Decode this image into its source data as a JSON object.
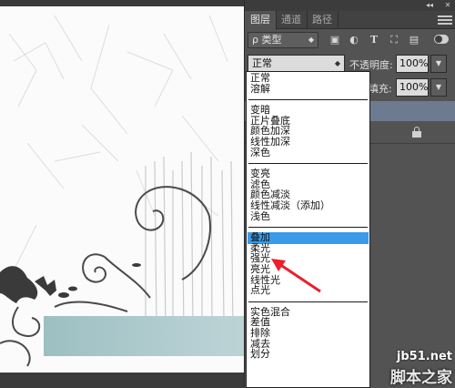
{
  "panel": {
    "collapse_icon": "double-chevron-icon",
    "close_icon": "close-icon",
    "tabs": [
      {
        "label": "图层",
        "active": true
      },
      {
        "label": "通道",
        "active": false
      },
      {
        "label": "路径",
        "active": false
      }
    ],
    "menu_icon": "hamburger-menu-icon"
  },
  "filter": {
    "label": "ρ 类型",
    "icons": [
      "image-filter-icon",
      "adjustment-filter-icon",
      "type-filter-icon",
      "shape-filter-icon",
      "smart-object-filter-icon"
    ]
  },
  "blend_mode": {
    "selected": "正常"
  },
  "opacity": {
    "label": "不透明度:",
    "value": "100%"
  },
  "fill": {
    "label": "填充:",
    "value": "100%"
  },
  "dropdown": {
    "groups": [
      [
        "正常",
        "溶解"
      ],
      [
        "变暗",
        "正片叠底",
        "颜色加深",
        "线性加深",
        "深色"
      ],
      [
        "变亮",
        "滤色",
        "颜色减淡",
        "线性减淡（添加）",
        "浅色"
      ],
      [
        "叠加",
        "柔光",
        "强光",
        "亮光",
        "线性光",
        "点光"
      ],
      [
        "实色混合",
        "差值",
        "排除",
        "减去",
        "划分"
      ]
    ],
    "selected": "叠加"
  },
  "colors": {
    "selection": "#3b9be8",
    "annotation_arrow": "#e8212d",
    "selected_layer": "#6d7b90"
  },
  "watermark": {
    "url": "jb51.net",
    "name": "脚本之家"
  }
}
